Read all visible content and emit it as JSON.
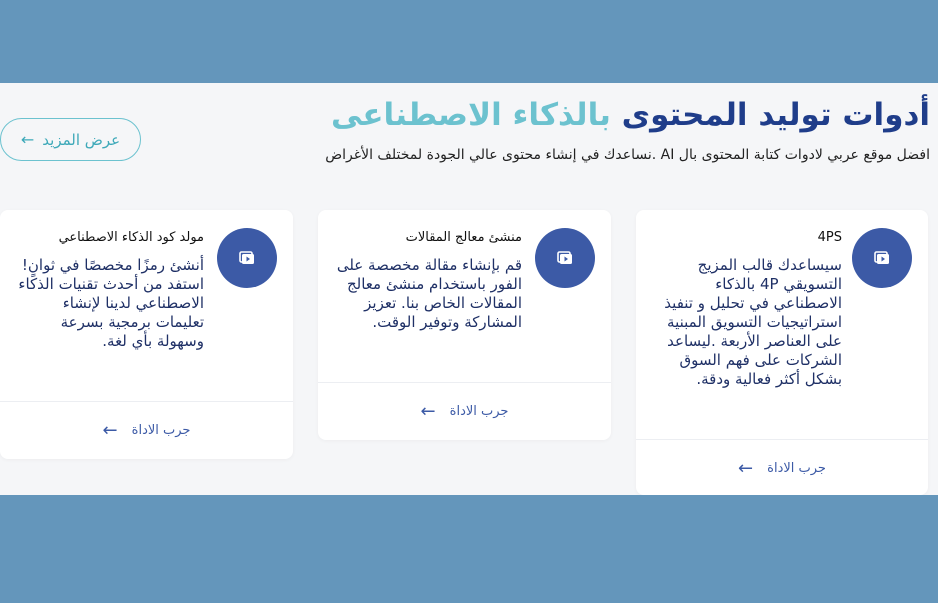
{
  "section": {
    "title_main": "أدوات توليد المحتوى",
    "title_accent": "بالذكاء الاصطناعى",
    "subtitle": "افضل موقع عربي لادوات كتابة المحتوى بال AI .نساعدك في إنشاء محتوى عالي الجودة لمختلف الأغراض",
    "more_button": {
      "label": "عرض المزيد",
      "arrow": "←"
    }
  },
  "cards": [
    {
      "icon": "video-play-icon",
      "title": "4PS",
      "description": "سيساعدك قالب المزيج التسويقي 4P بالذكاء الاصطناعي في تحليل و تنفيذ استراتيجيات التسويق المبنية على العناصر الأربعة .ليساعد الشركات على فهم السوق بشكل أكثر فعالية ودقة.",
      "cta_label": "جرب الاداة",
      "cta_arrow": "←"
    },
    {
      "icon": "video-play-icon",
      "title": "منشئ معالج المقالات",
      "description": "قم بإنشاء مقالة مخصصة على الفور باستخدام منشئ معالج المقالات الخاص بنا. تعزيز المشاركة وتوفير الوقت.",
      "cta_label": "جرب الاداة",
      "cta_arrow": "←"
    },
    {
      "icon": "video-play-icon",
      "title": "مولد كود الذكاء الاصطناعي",
      "description": "أنشئ رمزًا مخصصًا في ثوانٍ! استفد من أحدث تقنيات الذكاء الاصطناعي لدينا لإنشاء تعليمات برمجية بسرعة وسهولة بأي لغة.",
      "cta_label": "جرب الاداة",
      "cta_arrow": "←"
    }
  ],
  "colors": {
    "outer_bg": "#6496bb",
    "panel_bg": "#f5f6f8",
    "title_main": "#1f3d8a",
    "title_accent": "#6cc2cf",
    "icon_bg": "#3c5aa6"
  }
}
